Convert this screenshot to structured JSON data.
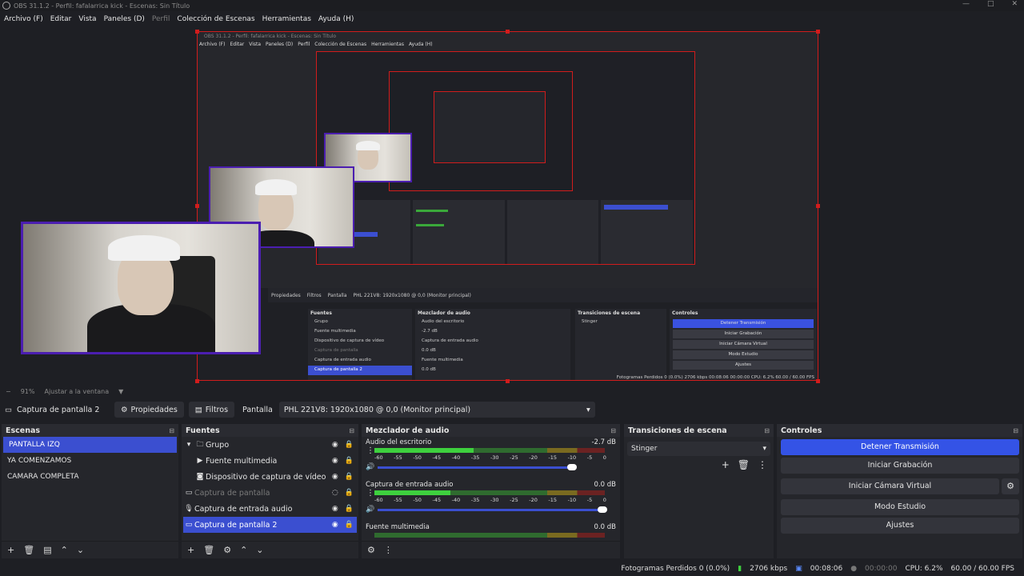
{
  "window": {
    "title": "OBS 31.1.2 - Perfil: fafalarrica kick - Escenas: Sin Título",
    "min": "—",
    "max": "□",
    "close": "✕"
  },
  "menu": [
    "Archivo (F)",
    "Editar",
    "Vista",
    "Paneles (D)",
    "Perfil",
    "Colección de Escenas",
    "Herramientas",
    "Ayuda (H)"
  ],
  "preview": {
    "nested_title": "OBS 31.1.2 - Perfil: fafalarrica kick - Escenas: Sin Título",
    "nested_menu": [
      "Archivo (F)",
      "Editar",
      "Vista",
      "Paneles (D)",
      "Perfil",
      "Colección de Escenas",
      "Herramientas",
      "Ayuda (H)"
    ],
    "nested_props": "Propiedades",
    "nested_filters": "Filtros",
    "nested_screen": "Pantalla",
    "nested_display": "PHL 221V8: 1920x1080 @ 0,0 (Monitor principal)",
    "nested_sources_title": "Fuentes",
    "nested_sources": [
      "Grupo",
      "Fuente multimedia",
      "Dispositivo de captura de vídeo",
      "Captura de pantalla",
      "Captura de entrada audio",
      "Captura de pantalla 2"
    ],
    "nested_mixer_title": "Mezclador de audio",
    "nested_mixer": [
      "Audio del escritorio",
      "Captura de entrada audio",
      "Fuente multimedia"
    ],
    "nested_mixer_db": [
      "-2.7 dB",
      "0.0 dB",
      "0.0 dB"
    ],
    "nested_trans_title": "Transiciones de escena",
    "nested_trans": "Stinger",
    "nested_ctrl_title": "Controles",
    "nested_controls": [
      "Detener Transmisión",
      "Iniciar Grabación",
      "Iniciar Cámara Virtual",
      "Modo Estudio",
      "Ajustes"
    ],
    "nested_status": "Fotogramas Perdidos 0 (0.0%)   2706 kbps   00:08:06   00:00:00   CPU: 6.2%   60.00 / 60.00 FPS"
  },
  "zoom": {
    "minus": "−",
    "percent": "91%",
    "fit": "Ajustar a la ventana",
    "arrow": "▼"
  },
  "source_toolbar": {
    "current_source": "Captura de pantalla 2",
    "properties": "Propiedades",
    "filters": "Filtros",
    "screen_label": "Pantalla",
    "display_value": "PHL 221V8: 1920x1080 @ 0,0 (Monitor principal)"
  },
  "scenes": {
    "title": "Escenas",
    "items": [
      "PANTALLA IZQ",
      "YA COMENZAMOS",
      "CAMARA COMPLETA"
    ]
  },
  "sources": {
    "title": "Fuentes",
    "items": [
      {
        "label": "Grupo",
        "icon": "folder-icon"
      },
      {
        "label": "Fuente multimedia",
        "icon": "play-icon"
      },
      {
        "label": "Dispositivo de captura de vídeo",
        "icon": "camera-icon"
      },
      {
        "label": "Captura de pantalla",
        "icon": "monitor-icon"
      },
      {
        "label": "Captura de entrada audio",
        "icon": "microphone-icon"
      },
      {
        "label": "Captura de pantalla 2",
        "icon": "monitor-icon"
      }
    ]
  },
  "mixer": {
    "title": "Mezclador de audio",
    "scale": [
      "-60",
      "-55",
      "-50",
      "-45",
      "-40",
      "-35",
      "-30",
      "-25",
      "-20",
      "-15",
      "-10",
      "-5",
      "0"
    ],
    "channels": [
      {
        "name": "Audio del escritorio",
        "db": "-2.7 dB",
        "level": 0.43,
        "volume": 0.86
      },
      {
        "name": "Captura de entrada audio",
        "db": "0.0 dB",
        "level": 0.33,
        "volume": 1.0
      },
      {
        "name": "Fuente multimedia",
        "db": "0.0 dB",
        "level": 0.0,
        "volume": 1.0
      }
    ]
  },
  "transitions": {
    "title": "Transiciones de escena",
    "selected": "Stinger"
  },
  "controls": {
    "title": "Controles",
    "stop_stream": "Detener Transmisión",
    "start_record": "Iniciar Grabación",
    "start_virtual_cam": "Iniciar Cámara Virtual",
    "studio_mode": "Modo Estudio",
    "settings": "Ajustes"
  },
  "status": {
    "dropped_frames": "Fotogramas Perdidos 0 (0.0%)",
    "bitrate": "2706 kbps",
    "stream_time": "00:08:06",
    "record_time": "00:00:00",
    "cpu": "CPU: 6.2%",
    "fps": "60.00 / 60.00 FPS"
  },
  "colors": {
    "accent": "#3b4fd0",
    "selection_border": "#d11c1c",
    "webcam_border": "#4b1eb0",
    "meter_green": "#3ed03e"
  }
}
